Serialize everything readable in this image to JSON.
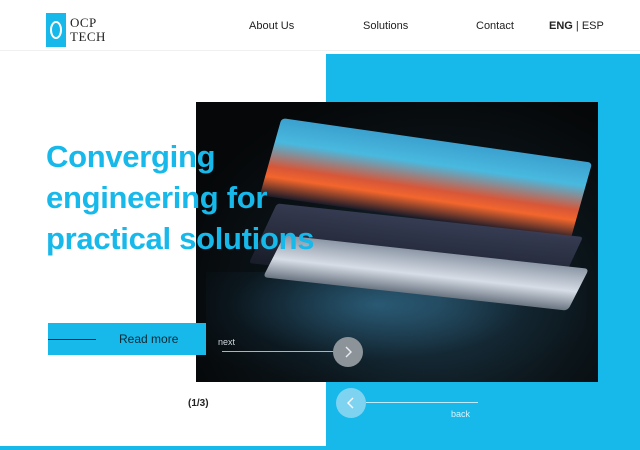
{
  "brand": {
    "logo_line1": "OCP",
    "logo_line2": "TECH"
  },
  "nav": {
    "items": [
      {
        "label": "About Us"
      },
      {
        "label": "Solutions"
      },
      {
        "label": "Contact"
      }
    ],
    "language": {
      "active": "ENG",
      "separator": " | ",
      "other": "ESP"
    }
  },
  "hero": {
    "headline_lines": [
      "Converging",
      "engineering for",
      "practical solutions"
    ],
    "cta_label": "Read more",
    "image_icon": "laptop-photo"
  },
  "slider": {
    "next_label": "next",
    "back_label": "back",
    "counter": "(1/3)",
    "current": 1,
    "total": 3
  },
  "colors": {
    "accent": "#17b8ea",
    "dark": "#050708",
    "text": "#222222"
  }
}
